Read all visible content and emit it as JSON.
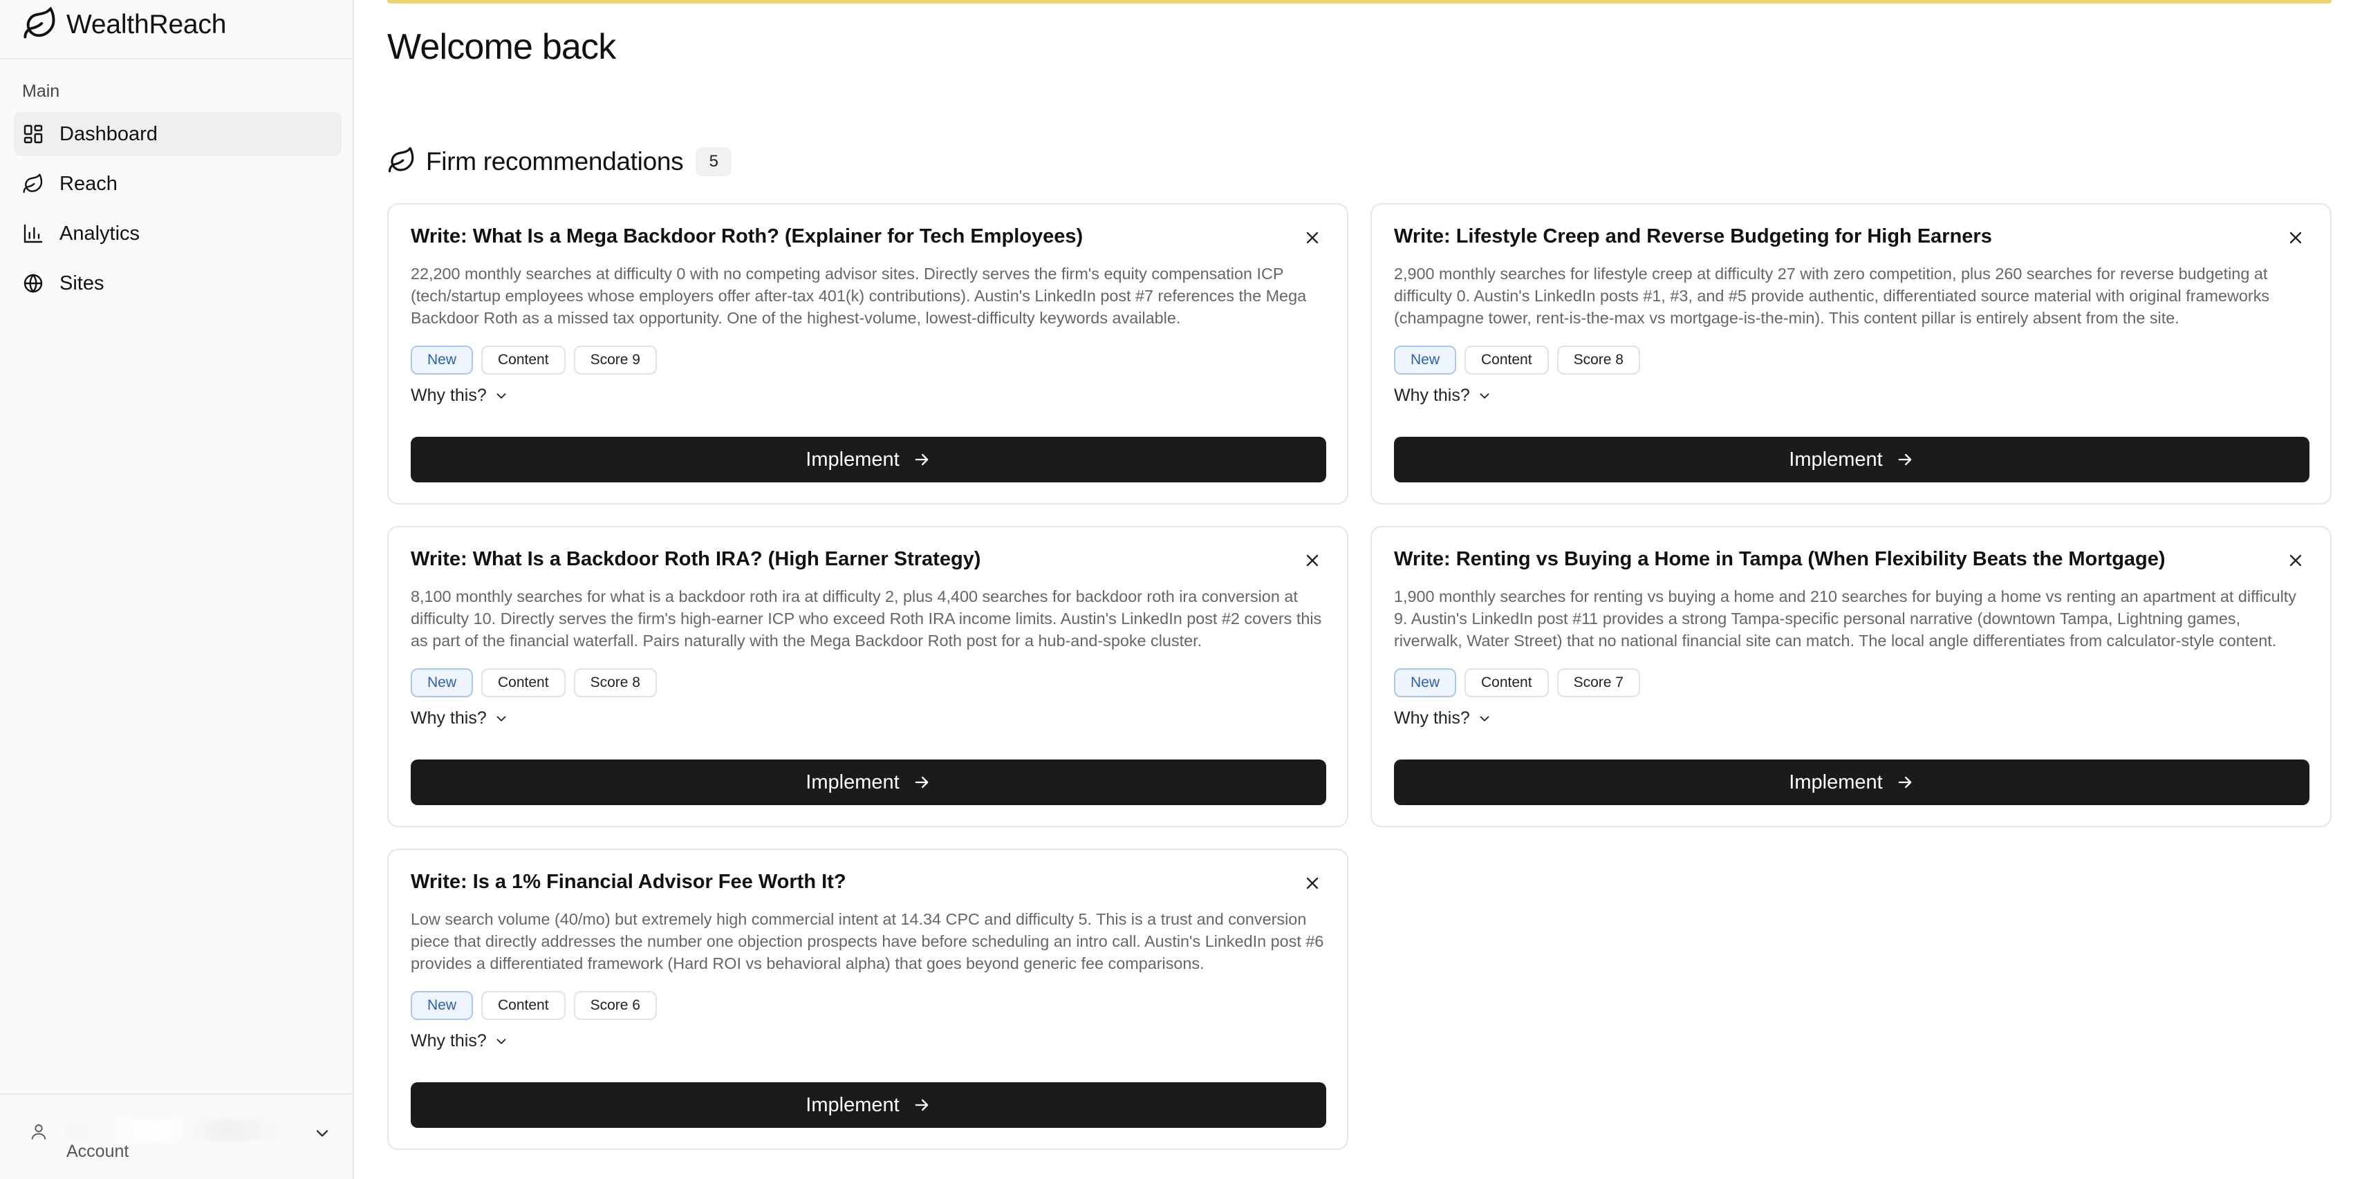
{
  "brand": {
    "name": "WealthReach"
  },
  "sidebar": {
    "section_label": "Main",
    "items": [
      {
        "label": "Dashboard",
        "icon": "grid-icon",
        "active": true
      },
      {
        "label": "Reach",
        "icon": "leaf-icon",
        "active": false
      },
      {
        "label": "Analytics",
        "icon": "bar-chart-icon",
        "active": false
      },
      {
        "label": "Sites",
        "icon": "globe-icon",
        "active": false
      }
    ],
    "account": {
      "label": "Account"
    }
  },
  "main": {
    "title": "Welcome back",
    "section": {
      "title": "Firm recommendations",
      "count": "5"
    },
    "cards": [
      {
        "title": "Write: What Is a Mega Backdoor Roth? (Explainer for Tech Employees)",
        "description": "22,200 monthly searches at difficulty 0 with no competing advisor sites. Directly serves the firm's equity compensation ICP (tech/startup employees whose employers offer after-tax 401(k) contributions). Austin's LinkedIn post #7 references the Mega Backdoor Roth as a missed tax opportunity. One of the highest-volume, lowest-difficulty keywords available.",
        "tags": {
          "status": "New",
          "type": "Content",
          "score": "Score 9"
        },
        "why_label": "Why this?",
        "button_label": "Implement"
      },
      {
        "title": "Write: Lifestyle Creep and Reverse Budgeting for High Earners",
        "description": "2,900 monthly searches for lifestyle creep at difficulty 27 with zero competition, plus 260 searches for reverse budgeting at difficulty 0. Austin's LinkedIn posts #1, #3, and #5 provide authentic, differentiated source material with original frameworks (champagne tower, rent-is-the-max vs mortgage-is-the-min). This content pillar is entirely absent from the site.",
        "tags": {
          "status": "New",
          "type": "Content",
          "score": "Score 8"
        },
        "why_label": "Why this?",
        "button_label": "Implement"
      },
      {
        "title": "Write: What Is a Backdoor Roth IRA? (High Earner Strategy)",
        "description": "8,100 monthly searches for what is a backdoor roth ira at difficulty 2, plus 4,400 searches for backdoor roth ira conversion at difficulty 10. Directly serves the firm's high-earner ICP who exceed Roth IRA income limits. Austin's LinkedIn post #2 covers this as part of the financial waterfall. Pairs naturally with the Mega Backdoor Roth post for a hub-and-spoke cluster.",
        "tags": {
          "status": "New",
          "type": "Content",
          "score": "Score 8"
        },
        "why_label": "Why this?",
        "button_label": "Implement"
      },
      {
        "title": "Write: Renting vs Buying a Home in Tampa (When Flexibility Beats the Mortgage)",
        "description": "1,900 monthly searches for renting vs buying a home and 210 searches for buying a home vs renting an apartment at difficulty 9. Austin's LinkedIn post #11 provides a strong Tampa-specific personal narrative (downtown Tampa, Lightning games, riverwalk, Water Street) that no national financial site can match. The local angle differentiates from calculator-style content.",
        "tags": {
          "status": "New",
          "type": "Content",
          "score": "Score 7"
        },
        "why_label": "Why this?",
        "button_label": "Implement"
      },
      {
        "title": "Write: Is a 1% Financial Advisor Fee Worth It?",
        "description": "Low search volume (40/mo) but extremely high commercial intent at 14.34 CPC and difficulty 5. This is a trust and conversion piece that directly addresses the number one objection prospects have before scheduling an intro call. Austin's LinkedIn post #6 provides a differentiated framework (Hard ROI vs behavioral alpha) that goes beyond generic fee comparisons.",
        "tags": {
          "status": "New",
          "type": "Content",
          "score": "Score 6"
        },
        "why_label": "Why this?",
        "button_label": "Implement"
      }
    ]
  },
  "colors": {
    "accent_yellow": "#ecd46a",
    "button_bg": "#1b1b1b",
    "tag_new_bg": "#eef5ff",
    "tag_new_text": "#2c5fb2"
  }
}
